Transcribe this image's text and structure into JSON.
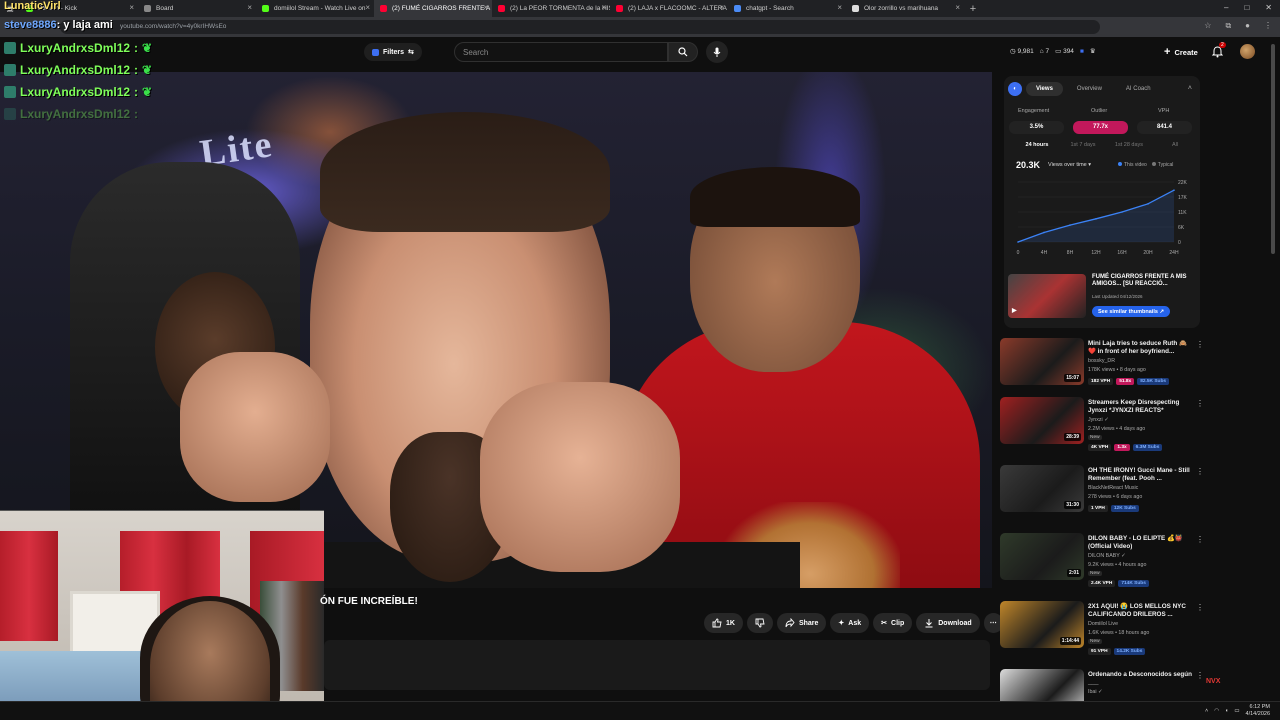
{
  "browser": {
    "tabs": [
      {
        "label": "Stream - Kick",
        "fav": "#53fc18"
      },
      {
        "label": "Board",
        "fav": "#888888"
      },
      {
        "label": "domiilol Stream - Watch Live on",
        "fav": "#53fc18"
      },
      {
        "label": "(2) FUMÉ CIGARROS FRENTE A M",
        "fav": "#ff0033",
        "active": true
      },
      {
        "label": "(2) La PEOR TORMENTA de la HIS",
        "fav": "#ff0033"
      },
      {
        "label": "(2) LAJA x FLACOOMC - ALTERA",
        "fav": "#ff0033"
      },
      {
        "label": "chatgpt - Search",
        "fav": "#4b8bf5"
      },
      {
        "label": "Olor zorrillo vs marihuana",
        "fav": "#dddddd"
      }
    ],
    "url": "youtube.com/watch?v=4y0krIHWsEo"
  },
  "youtube": {
    "filters_label": "Filters",
    "search_placeholder": "Search",
    "header_stats": {
      "views": "9,981",
      "a": "7",
      "b": "394"
    },
    "create_label": "Create",
    "notif_count": "2"
  },
  "chat": {
    "streamer": "LunaticVirl",
    "steve_name": "steve8886",
    "steve_text": ": y laja ami",
    "user": "LxuryAndrxsDml12",
    "sep": ":"
  },
  "video": {
    "title_fragment": "ÓN FUE INCREÍBLE!",
    "overlay_sign": "Lite",
    "actions": {
      "like_count": "1K",
      "share": "Share",
      "ask": "Ask",
      "clip": "Clip",
      "download": "Download"
    }
  },
  "analytics": {
    "tabs": [
      "Views",
      "Overview",
      "AI Coach"
    ],
    "kpi_labels": [
      "Engagement",
      "Outlier",
      "VPH"
    ],
    "kpi_values": [
      "3.5%",
      "77.7x",
      "841.4"
    ],
    "ranges": [
      "24 hours",
      "1st 7 days",
      "1st 28 days",
      "All"
    ],
    "total": "20.3K",
    "metric": "Views over time",
    "legend": [
      "This video",
      "Typical"
    ],
    "accent": "#3b82f6",
    "video_title": "FUMÉ CIGARROS FRENTE A MIS AMIGOS... [SU REACCIÓ...",
    "video_date": "Last Updated 04/12/2026",
    "similar_btn": "See similar thumbnails"
  },
  "chart_data": {
    "type": "line",
    "xlabel": "",
    "ylabel": "",
    "x": [
      "0",
      "4H",
      "8H",
      "12H",
      "16H",
      "20H",
      "24H"
    ],
    "y_ticks": [
      "22K",
      "17K",
      "11K",
      "6K",
      "0"
    ],
    "ylim": [
      0,
      22000
    ],
    "series": [
      {
        "name": "This video",
        "values": [
          0,
          3500,
          6200,
          8500,
          11000,
          14000,
          19000
        ]
      }
    ],
    "grid": true
  },
  "recommendations": [
    {
      "title": "Mini Laja tries to seduce Ruth 🙈❤️ in front of her boyfriend...",
      "channel": "bossky_DR",
      "meta": "178K views • 8 days ago",
      "duration": "15:07",
      "new": "",
      "vph": "182 VPH",
      "outlier": "51.8x",
      "subs": "82.5K Subs",
      "thumb": "#8a3a2a"
    },
    {
      "title": "Streamers Keep Disrespecting Jynxzi *JYNXZI REACTS*",
      "channel": "Jynxzi ✓",
      "meta": "2.2M views • 4 days ago",
      "duration": "28:39",
      "new": "New",
      "vph": "4K VPH",
      "outlier": "1.3x",
      "subs": "6.3M Subs",
      "thumb": "#a02020"
    },
    {
      "title": "OH THE IRONY! Gucci Mane - Still Remember (feat. Pooh ...",
      "channel": "BlackNetReact Music",
      "meta": "278 views • 6 days ago",
      "duration": "31:30",
      "new": "",
      "vph": "1 VPH",
      "outlier": "",
      "subs": "12K Subs",
      "thumb": "#3a3a3a"
    },
    {
      "title": "DILON BABY - LO ELIPTE 💰👹 (Official Video)",
      "channel": "DILON BABY ✓",
      "meta": "9.2K views • 4 hours ago",
      "duration": "2:01",
      "new": "New",
      "vph": "2.4K VPH",
      "outlier": "",
      "subs": "714K Subs",
      "thumb": "#2f3a2a"
    },
    {
      "title": "2X1 AQUI! 😭 LOS MELLOS NYC CALIFICANDO DRILEROS ...",
      "channel": "Domiilol Live",
      "meta": "1.6K views • 18 hours ago",
      "duration": "1:14:44",
      "new": "New",
      "vph": "91 VPH",
      "outlier": "",
      "subs": "14.2K Subs",
      "thumb": "#c0862a"
    },
    {
      "title": "Ordenando a Desconocidos según ___",
      "channel": "Ibai ✓",
      "meta": "",
      "duration": "",
      "new": "",
      "vph": "",
      "outlier": "",
      "subs": "",
      "thumb": "#dddddd"
    }
  ],
  "taskbar": {
    "time": "6:12 PM",
    "date": "4/14/2026"
  },
  "overlay_tag": "NVX"
}
